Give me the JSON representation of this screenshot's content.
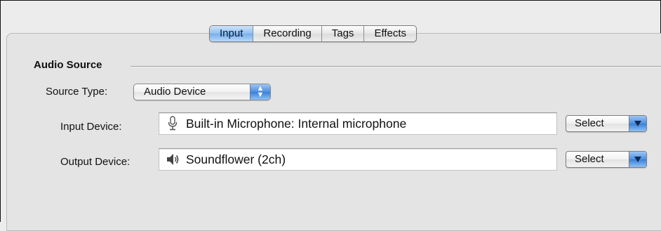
{
  "tabs": [
    {
      "label": "Input",
      "selected": true
    },
    {
      "label": "Recording",
      "selected": false
    },
    {
      "label": "Tags",
      "selected": false
    },
    {
      "label": "Effects",
      "selected": false
    }
  ],
  "audio_source": {
    "title": "Audio Source",
    "source_type": {
      "label": "Source Type:",
      "value": "Audio Device"
    },
    "input_device": {
      "label": "Input Device:",
      "icon": "microphone-icon",
      "value": "Built-in Microphone: Internal microphone",
      "button": "Select"
    },
    "output_device": {
      "label": "Output Device:",
      "icon": "speaker-icon",
      "value": "Soundflower (2ch)",
      "button": "Select"
    }
  },
  "colors": {
    "accent": "#5a9be6",
    "selected_tab": "#8fbef0"
  }
}
